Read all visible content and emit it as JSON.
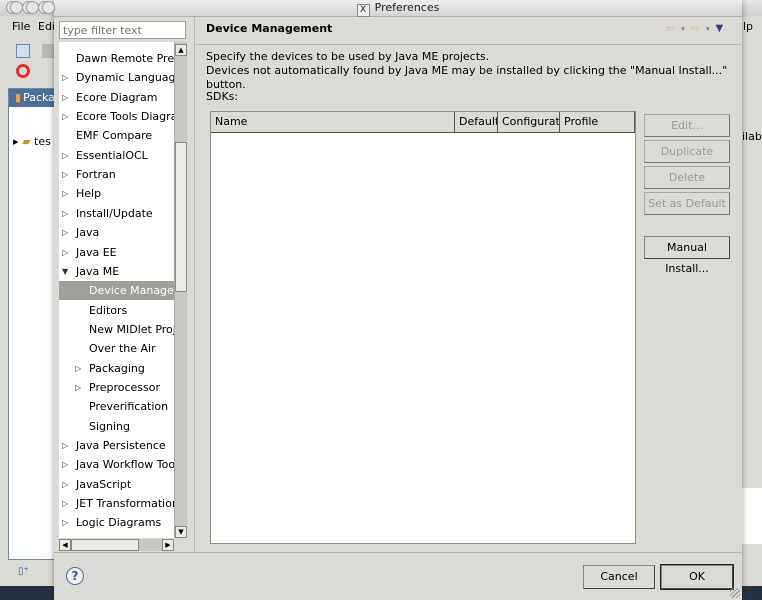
{
  "background_window": {
    "menu": [
      "File",
      "Edi"
    ],
    "package_tab": "Packa",
    "tree_item": "tes",
    "right_menu_fragment": "lp",
    "right_text_fragment": "ilab"
  },
  "dialog": {
    "title": "Preferences",
    "filter": {
      "placeholder": "type filter text",
      "value": ""
    },
    "tree": [
      {
        "label": "Dawn Remote Prefe",
        "level": 0,
        "expander": "none"
      },
      {
        "label": "Dynamic Languages",
        "level": 0,
        "expander": "collapsed"
      },
      {
        "label": "Ecore Diagram",
        "level": 0,
        "expander": "collapsed"
      },
      {
        "label": "Ecore Tools Diagram",
        "level": 0,
        "expander": "collapsed"
      },
      {
        "label": "EMF Compare",
        "level": 0,
        "expander": "none"
      },
      {
        "label": "EssentialOCL",
        "level": 0,
        "expander": "collapsed"
      },
      {
        "label": "Fortran",
        "level": 0,
        "expander": "collapsed"
      },
      {
        "label": "Help",
        "level": 0,
        "expander": "collapsed"
      },
      {
        "label": "Install/Update",
        "level": 0,
        "expander": "collapsed"
      },
      {
        "label": "Java",
        "level": 0,
        "expander": "collapsed"
      },
      {
        "label": "Java EE",
        "level": 0,
        "expander": "collapsed"
      },
      {
        "label": "Java ME",
        "level": 0,
        "expander": "expanded"
      },
      {
        "label": "Device Management",
        "level": 1,
        "expander": "none",
        "selected": true
      },
      {
        "label": "Editors",
        "level": 1,
        "expander": "none"
      },
      {
        "label": "New MIDlet Project",
        "level": 1,
        "expander": "none"
      },
      {
        "label": "Over the Air",
        "level": 1,
        "expander": "none"
      },
      {
        "label": "Packaging",
        "level": 1,
        "expander": "collapsed"
      },
      {
        "label": "Preprocessor",
        "level": 1,
        "expander": "collapsed"
      },
      {
        "label": "Preverification",
        "level": 1,
        "expander": "none"
      },
      {
        "label": "Signing",
        "level": 1,
        "expander": "none"
      },
      {
        "label": "Java Persistence",
        "level": 0,
        "expander": "collapsed"
      },
      {
        "label": "Java Workflow Tooling",
        "level": 0,
        "expander": "collapsed"
      },
      {
        "label": "JavaScript",
        "level": 0,
        "expander": "collapsed"
      },
      {
        "label": "JET Transformations",
        "level": 0,
        "expander": "collapsed"
      },
      {
        "label": "Logic Diagrams",
        "level": 0,
        "expander": "collapsed"
      }
    ],
    "page": {
      "title": "Device Management",
      "description_line1": "Specify the devices to be used by Java ME projects.",
      "description_line2": "Devices not automatically found by Java ME may be installed by clicking the \"Manual Install...\" button.",
      "sdks_label": "SDKs:",
      "table_columns": [
        "Name",
        "Default",
        "Configurati",
        "Profile"
      ],
      "table_rows": [],
      "buttons": [
        {
          "label": "Edit...",
          "enabled": false
        },
        {
          "label": "Duplicate",
          "enabled": false
        },
        {
          "label": "Delete",
          "enabled": false
        },
        {
          "label": "Set as Default",
          "enabled": false
        },
        {
          "label": "Manual Install...",
          "enabled": true
        }
      ]
    },
    "footer": {
      "help": "?",
      "cancel": "Cancel",
      "ok": "OK"
    }
  }
}
